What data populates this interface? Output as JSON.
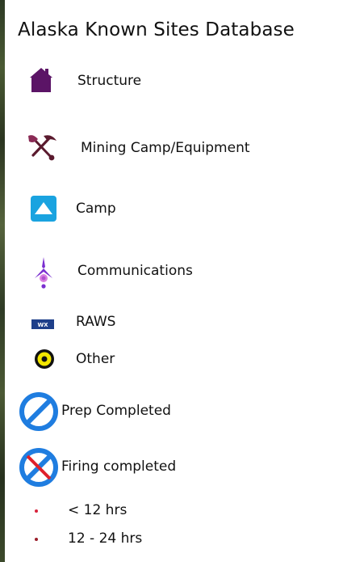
{
  "legend": {
    "title": "Alaska Known Sites Database",
    "items": [
      {
        "label": "Structure",
        "icon": "house-icon",
        "color": "#5b1466"
      },
      {
        "label": "Mining Camp/Equipment",
        "icon": "pick-shovel-icon",
        "color": "#6d1f3f"
      },
      {
        "label": "Camp",
        "icon": "tent-icon",
        "color": "#1aa3e0"
      },
      {
        "label": "Communications",
        "icon": "antenna-icon",
        "color": "#7b2fd0"
      },
      {
        "label": "RAWS",
        "icon": "weather-station-icon",
        "color": "#1e3f8a"
      },
      {
        "label": "Other",
        "icon": "target-icon",
        "color": "#f2e600"
      },
      {
        "label": "Prep Completed",
        "icon": "prep-completed-icon",
        "color": "#1f7de0"
      },
      {
        "label": "Firing completed",
        "icon": "firing-completed-icon",
        "color": "#e0202a"
      },
      {
        "label": "< 12 hrs",
        "icon": "small-dot-icon",
        "color": "#d8233c"
      },
      {
        "label": "12 - 24 hrs",
        "icon": "small-dot-icon",
        "color": "#9a1e2a"
      }
    ]
  }
}
